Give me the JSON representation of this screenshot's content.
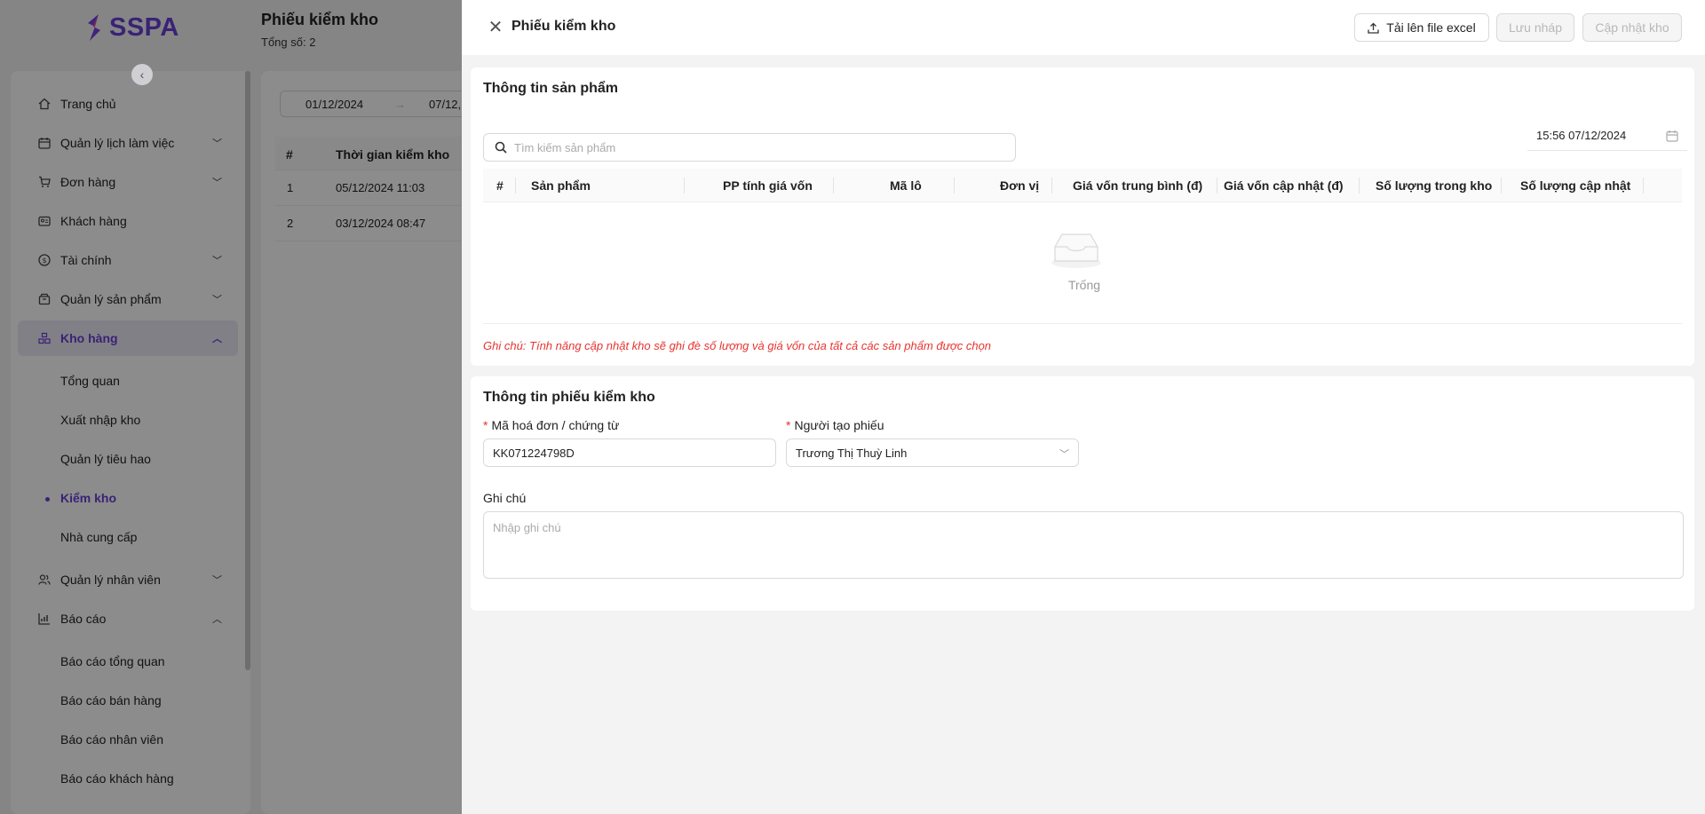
{
  "brand": {
    "logo_text": "SSPA",
    "accent": "#6a3fd6"
  },
  "sidebar": {
    "items": [
      {
        "label": "Trang chủ",
        "icon": "home-icon"
      },
      {
        "label": "Quản lý lịch làm việc",
        "icon": "calendar-icon",
        "expandable": true
      },
      {
        "label": "Đơn hàng",
        "icon": "cart-icon",
        "expandable": true
      },
      {
        "label": "Khách hàng",
        "icon": "id-card-icon"
      },
      {
        "label": "Tài chính",
        "icon": "dollar-icon",
        "expandable": true
      },
      {
        "label": "Quản lý sản phẩm",
        "icon": "box-icon",
        "expandable": true
      },
      {
        "label": "Kho hàng",
        "icon": "warehouse-icon",
        "expanded": true,
        "active": true
      },
      {
        "label": "Quản lý nhân viên",
        "icon": "users-icon",
        "expandable": true
      },
      {
        "label": "Báo cáo",
        "icon": "chart-icon",
        "expanded": true
      }
    ],
    "warehouse_sub": [
      "Tổng quan",
      "Xuất nhập kho",
      "Quản lý tiêu hao",
      "Kiểm kho",
      "Nhà cung cấp"
    ],
    "report_sub": [
      "Báo cáo tổng quan",
      "Báo cáo bán hàng",
      "Báo cáo nhân viên",
      "Báo cáo khách hàng"
    ]
  },
  "background_page": {
    "title": "Phiếu kiểm kho",
    "total": "Tổng số: 2",
    "date_from": "01/12/2024",
    "date_to": "07/12,",
    "columns": [
      "#",
      "Thời gian kiểm kho"
    ],
    "rows": [
      {
        "index": "1",
        "time": "05/12/2024 11:03"
      },
      {
        "index": "2",
        "time": "03/12/2024 08:47"
      }
    ]
  },
  "drawer": {
    "title": "Phiếu kiểm kho",
    "buttons": {
      "upload": "Tải lên file excel",
      "save_draft": "Lưu nháp",
      "update_stock": "Cập nhật kho"
    },
    "product_section": {
      "title": "Thông tin sản phẩm",
      "search_placeholder": "Tìm kiếm sản phẩm",
      "datetime": "15:56 07/12/2024",
      "columns": [
        "#",
        "Sản phẩm",
        "PP tính giá vốn",
        "Mã lô",
        "Đơn vị",
        "Giá vốn trung bình (đ)",
        "Giá vốn cập nhật (đ)",
        "Số lượng trong kho",
        "Số lượng cập nhật"
      ],
      "empty_text": "Trống",
      "note": "Ghi chú: Tính năng cập nhật kho sẽ ghi đè số lượng và giá vốn của tất cả các sản phẩm được chọn"
    },
    "receipt_section": {
      "title": "Thông tin phiếu kiểm kho",
      "code_label": "Mã hoá đơn / chứng từ",
      "code_value": "KK071224798D",
      "creator_label": "Người tạo phiếu",
      "creator_value": "Trương Thị Thuỳ Linh",
      "note_label": "Ghi chú",
      "note_placeholder": "Nhập ghi chú"
    }
  }
}
